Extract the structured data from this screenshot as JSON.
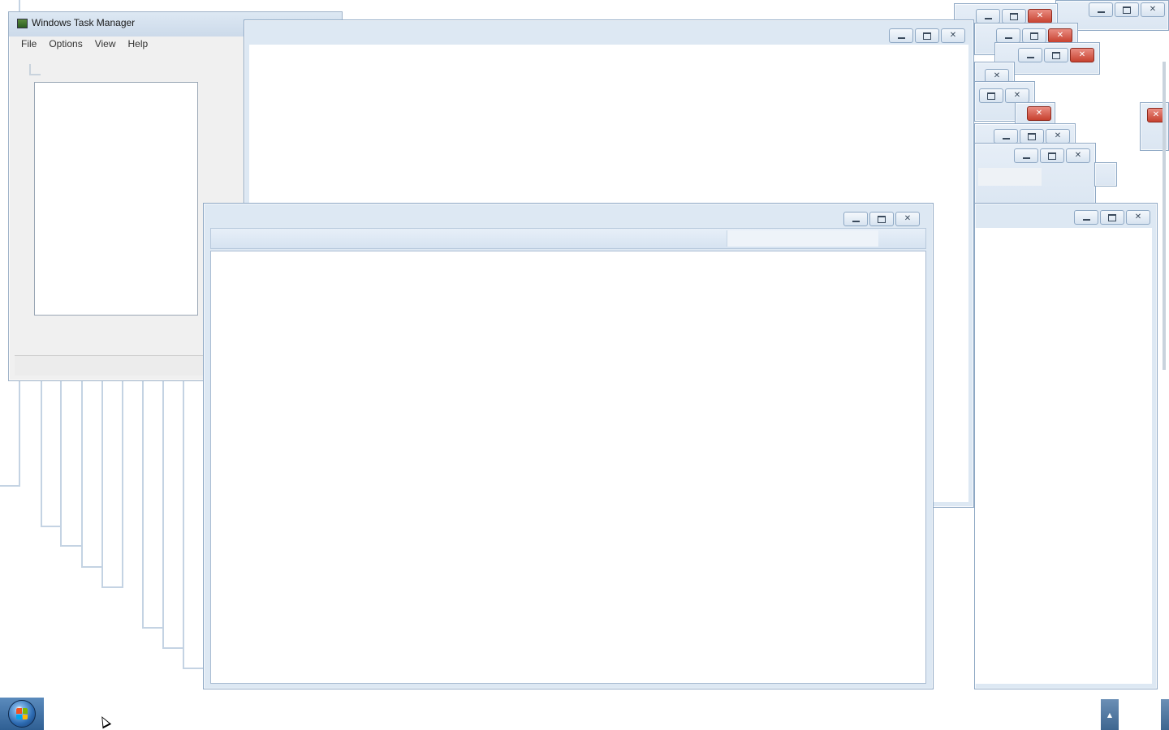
{
  "taskmanager": {
    "title": "Windows Task Manager",
    "menu": [
      "File",
      "Options",
      "View",
      "Help"
    ]
  },
  "icons": {
    "minimize": "minimize-icon",
    "maximize": "maximize-icon",
    "close": "close-icon",
    "start": "windows-start-orb-icon",
    "tray": "show-hidden-icons-arrow-icon"
  },
  "colors": {
    "frame": "#dde8f3",
    "close_active": "#c7412f",
    "taskbar_accent": "#2f5f93"
  }
}
